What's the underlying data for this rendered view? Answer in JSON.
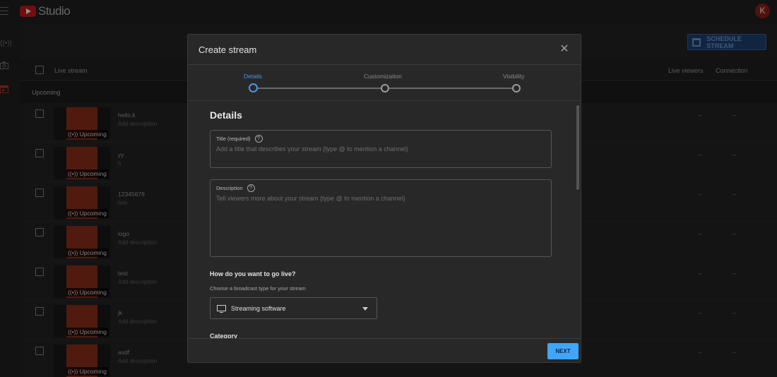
{
  "app": {
    "brand": "Studio",
    "avatar_letter": "K"
  },
  "header": {
    "schedule_button": "SCHEDULE STREAM"
  },
  "table": {
    "columns": {
      "live_stream": "Live stream",
      "live_viewers": "Live viewers",
      "connection": "Connection"
    },
    "group": "Upcoming",
    "badge": "Upcoming",
    "dash": "–",
    "rows": [
      {
        "title": "hello.k",
        "desc": "Add description"
      },
      {
        "title": "yy",
        "desc": "h"
      },
      {
        "title": "12345678",
        "desc": "hhh"
      },
      {
        "title": "logo",
        "desc": "Add description"
      },
      {
        "title": "test",
        "desc": "Add description"
      },
      {
        "title": "jk",
        "desc": "Add description"
      },
      {
        "title": "asdf",
        "desc": "Add description"
      }
    ]
  },
  "dialog": {
    "title": "Create stream",
    "steps": [
      "Details",
      "Customization",
      "Visibility"
    ],
    "active_step": 0,
    "section_title": "Details",
    "title_field": {
      "label": "Title (required)",
      "placeholder": "Add a title that describes your stream (type @ to mention a channel)"
    },
    "description_field": {
      "label": "Description",
      "placeholder": "Tell viewers more about your stream (type @ to mention a channel)"
    },
    "go_live_question": "How do you want to go live?",
    "go_live_sub": "Choose a broadcast type for your stream",
    "broadcast_type": "Streaming software",
    "category_label": "Category",
    "next_button": "NEXT"
  },
  "colors": {
    "accent": "#3ea6ff",
    "step_active": "#4e95e8",
    "thumb": "#7c2a16",
    "brand_red": "#b21414"
  }
}
